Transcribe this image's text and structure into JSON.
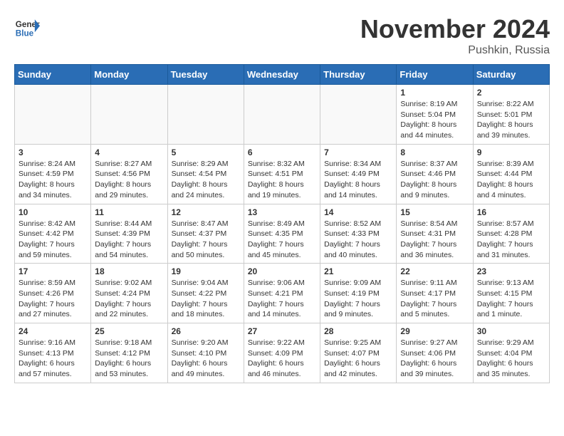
{
  "logo": {
    "general": "General",
    "blue": "Blue"
  },
  "title": {
    "month": "November 2024",
    "location": "Pushkin, Russia"
  },
  "weekdays": [
    "Sunday",
    "Monday",
    "Tuesday",
    "Wednesday",
    "Thursday",
    "Friday",
    "Saturday"
  ],
  "weeks": [
    [
      {
        "day": "",
        "info": ""
      },
      {
        "day": "",
        "info": ""
      },
      {
        "day": "",
        "info": ""
      },
      {
        "day": "",
        "info": ""
      },
      {
        "day": "",
        "info": ""
      },
      {
        "day": "1",
        "info": "Sunrise: 8:19 AM\nSunset: 5:04 PM\nDaylight: 8 hours\nand 44 minutes."
      },
      {
        "day": "2",
        "info": "Sunrise: 8:22 AM\nSunset: 5:01 PM\nDaylight: 8 hours\nand 39 minutes."
      }
    ],
    [
      {
        "day": "3",
        "info": "Sunrise: 8:24 AM\nSunset: 4:59 PM\nDaylight: 8 hours\nand 34 minutes."
      },
      {
        "day": "4",
        "info": "Sunrise: 8:27 AM\nSunset: 4:56 PM\nDaylight: 8 hours\nand 29 minutes."
      },
      {
        "day": "5",
        "info": "Sunrise: 8:29 AM\nSunset: 4:54 PM\nDaylight: 8 hours\nand 24 minutes."
      },
      {
        "day": "6",
        "info": "Sunrise: 8:32 AM\nSunset: 4:51 PM\nDaylight: 8 hours\nand 19 minutes."
      },
      {
        "day": "7",
        "info": "Sunrise: 8:34 AM\nSunset: 4:49 PM\nDaylight: 8 hours\nand 14 minutes."
      },
      {
        "day": "8",
        "info": "Sunrise: 8:37 AM\nSunset: 4:46 PM\nDaylight: 8 hours\nand 9 minutes."
      },
      {
        "day": "9",
        "info": "Sunrise: 8:39 AM\nSunset: 4:44 PM\nDaylight: 8 hours\nand 4 minutes."
      }
    ],
    [
      {
        "day": "10",
        "info": "Sunrise: 8:42 AM\nSunset: 4:42 PM\nDaylight: 7 hours\nand 59 minutes."
      },
      {
        "day": "11",
        "info": "Sunrise: 8:44 AM\nSunset: 4:39 PM\nDaylight: 7 hours\nand 54 minutes."
      },
      {
        "day": "12",
        "info": "Sunrise: 8:47 AM\nSunset: 4:37 PM\nDaylight: 7 hours\nand 50 minutes."
      },
      {
        "day": "13",
        "info": "Sunrise: 8:49 AM\nSunset: 4:35 PM\nDaylight: 7 hours\nand 45 minutes."
      },
      {
        "day": "14",
        "info": "Sunrise: 8:52 AM\nSunset: 4:33 PM\nDaylight: 7 hours\nand 40 minutes."
      },
      {
        "day": "15",
        "info": "Sunrise: 8:54 AM\nSunset: 4:31 PM\nDaylight: 7 hours\nand 36 minutes."
      },
      {
        "day": "16",
        "info": "Sunrise: 8:57 AM\nSunset: 4:28 PM\nDaylight: 7 hours\nand 31 minutes."
      }
    ],
    [
      {
        "day": "17",
        "info": "Sunrise: 8:59 AM\nSunset: 4:26 PM\nDaylight: 7 hours\nand 27 minutes."
      },
      {
        "day": "18",
        "info": "Sunrise: 9:02 AM\nSunset: 4:24 PM\nDaylight: 7 hours\nand 22 minutes."
      },
      {
        "day": "19",
        "info": "Sunrise: 9:04 AM\nSunset: 4:22 PM\nDaylight: 7 hours\nand 18 minutes."
      },
      {
        "day": "20",
        "info": "Sunrise: 9:06 AM\nSunset: 4:21 PM\nDaylight: 7 hours\nand 14 minutes."
      },
      {
        "day": "21",
        "info": "Sunrise: 9:09 AM\nSunset: 4:19 PM\nDaylight: 7 hours\nand 9 minutes."
      },
      {
        "day": "22",
        "info": "Sunrise: 9:11 AM\nSunset: 4:17 PM\nDaylight: 7 hours\nand 5 minutes."
      },
      {
        "day": "23",
        "info": "Sunrise: 9:13 AM\nSunset: 4:15 PM\nDaylight: 7 hours\nand 1 minute."
      }
    ],
    [
      {
        "day": "24",
        "info": "Sunrise: 9:16 AM\nSunset: 4:13 PM\nDaylight: 6 hours\nand 57 minutes."
      },
      {
        "day": "25",
        "info": "Sunrise: 9:18 AM\nSunset: 4:12 PM\nDaylight: 6 hours\nand 53 minutes."
      },
      {
        "day": "26",
        "info": "Sunrise: 9:20 AM\nSunset: 4:10 PM\nDaylight: 6 hours\nand 49 minutes."
      },
      {
        "day": "27",
        "info": "Sunrise: 9:22 AM\nSunset: 4:09 PM\nDaylight: 6 hours\nand 46 minutes."
      },
      {
        "day": "28",
        "info": "Sunrise: 9:25 AM\nSunset: 4:07 PM\nDaylight: 6 hours\nand 42 minutes."
      },
      {
        "day": "29",
        "info": "Sunrise: 9:27 AM\nSunset: 4:06 PM\nDaylight: 6 hours\nand 39 minutes."
      },
      {
        "day": "30",
        "info": "Sunrise: 9:29 AM\nSunset: 4:04 PM\nDaylight: 6 hours\nand 35 minutes."
      }
    ]
  ]
}
